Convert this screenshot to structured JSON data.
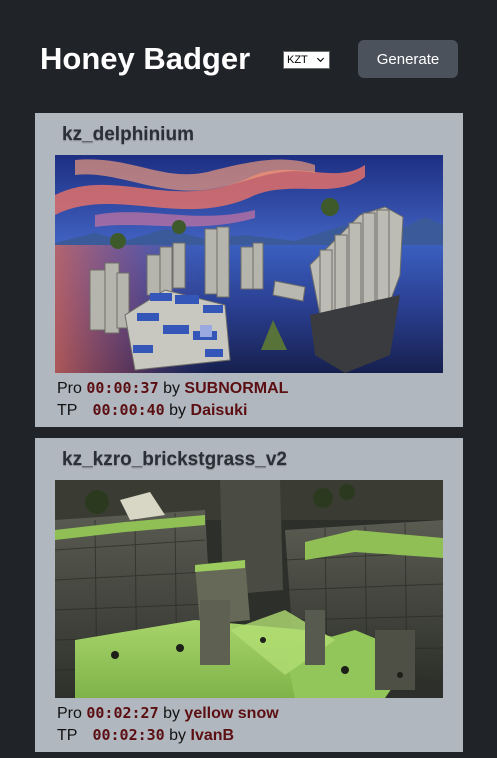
{
  "header": {
    "title": "Honey Badger",
    "mode_select": {
      "value": "KZT",
      "icon": "chevron-down-icon"
    },
    "generate_label": "Generate"
  },
  "maps": [
    {
      "name": "kz_delphinium",
      "screenshot_icon": "map-screenshot",
      "records": [
        {
          "type": "Pro",
          "time": "00:00:37",
          "by": "by",
          "player": "SUBNORMAL"
        },
        {
          "type": "TP",
          "time": "00:00:40",
          "by": "by",
          "player": "Daisuki"
        }
      ]
    },
    {
      "name": "kz_kzro_brickstgrass_v2",
      "screenshot_icon": "map-screenshot",
      "records": [
        {
          "type": "Pro",
          "time": "00:02:27",
          "by": "by",
          "player": "yellow snow"
        },
        {
          "type": "TP",
          "time": "00:02:30",
          "by": "by",
          "player": "IvanB"
        }
      ]
    }
  ],
  "colors": {
    "background": "#202328",
    "card": "#b1b7bf",
    "button": "#4c525b",
    "accent_text": "#5b0f12"
  }
}
